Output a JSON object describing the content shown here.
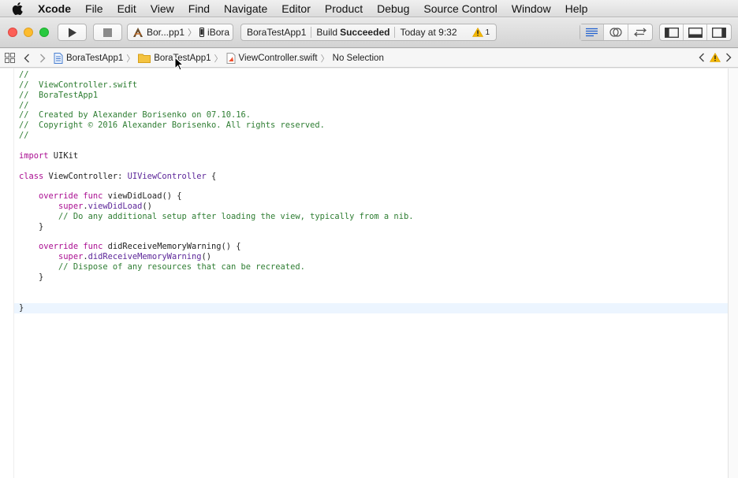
{
  "menubar": {
    "app": "Xcode",
    "items": [
      "File",
      "Edit",
      "View",
      "Find",
      "Navigate",
      "Editor",
      "Product",
      "Debug",
      "Source Control",
      "Window",
      "Help"
    ]
  },
  "toolbar": {
    "scheme_name": "Bor...pp1",
    "scheme_separator": "〉",
    "device_name": "iBora",
    "activity_project": "BoraTestApp1",
    "activity_status_prefix": "Build",
    "activity_status": "Succeeded",
    "activity_time": "Today at 9:32",
    "warning_count": "1"
  },
  "jumpbar": {
    "crumbs": [
      "BoraTestApp1",
      "BoraTestApp1",
      "ViewController.swift",
      "No Selection"
    ],
    "separator": "〉"
  },
  "code": {
    "lines": [
      [
        {
          "t": "//",
          "c": "comment"
        }
      ],
      [
        {
          "t": "//  ViewController.swift",
          "c": "comment"
        }
      ],
      [
        {
          "t": "//  BoraTestApp1",
          "c": "comment"
        }
      ],
      [
        {
          "t": "//",
          "c": "comment"
        }
      ],
      [
        {
          "t": "//  Created by Alexander Borisenko on 07.10.16.",
          "c": "comment"
        }
      ],
      [
        {
          "t": "//  Copyright © 2016 Alexander Borisenko. All rights reserved.",
          "c": "comment"
        }
      ],
      [
        {
          "t": "//",
          "c": "comment"
        }
      ],
      [],
      [
        {
          "t": "import",
          "c": "keyword"
        },
        {
          "t": " UIKit",
          "c": "text"
        }
      ],
      [],
      [
        {
          "t": "class",
          "c": "keyword"
        },
        {
          "t": " ViewController: ",
          "c": "text"
        },
        {
          "t": "UIViewController",
          "c": "class"
        },
        {
          "t": " {",
          "c": "text"
        }
      ],
      [],
      [
        {
          "t": "    override",
          "c": "keyword"
        },
        {
          "t": " ",
          "c": "text"
        },
        {
          "t": "func",
          "c": "keyword"
        },
        {
          "t": " viewDidLoad() {",
          "c": "text"
        }
      ],
      [
        {
          "t": "        super",
          "c": "keyword"
        },
        {
          "t": ".",
          "c": "text"
        },
        {
          "t": "viewDidLoad",
          "c": "class"
        },
        {
          "t": "()",
          "c": "text"
        }
      ],
      [
        {
          "t": "        // Do any additional setup after loading the view, typically from a nib.",
          "c": "comment"
        }
      ],
      [
        {
          "t": "    }",
          "c": "text"
        }
      ],
      [],
      [
        {
          "t": "    override",
          "c": "keyword"
        },
        {
          "t": " ",
          "c": "text"
        },
        {
          "t": "func",
          "c": "keyword"
        },
        {
          "t": " didReceiveMemoryWarning() {",
          "c": "text"
        }
      ],
      [
        {
          "t": "        super",
          "c": "keyword"
        },
        {
          "t": ".",
          "c": "text"
        },
        {
          "t": "didReceiveMemoryWarning",
          "c": "class"
        },
        {
          "t": "()",
          "c": "text"
        }
      ],
      [
        {
          "t": "        // Dispose of any resources that can be recreated.",
          "c": "comment"
        }
      ],
      [
        {
          "t": "    }",
          "c": "text"
        }
      ],
      [],
      [],
      [
        {
          "t": "}",
          "c": "text"
        }
      ]
    ],
    "current_line": 23
  }
}
